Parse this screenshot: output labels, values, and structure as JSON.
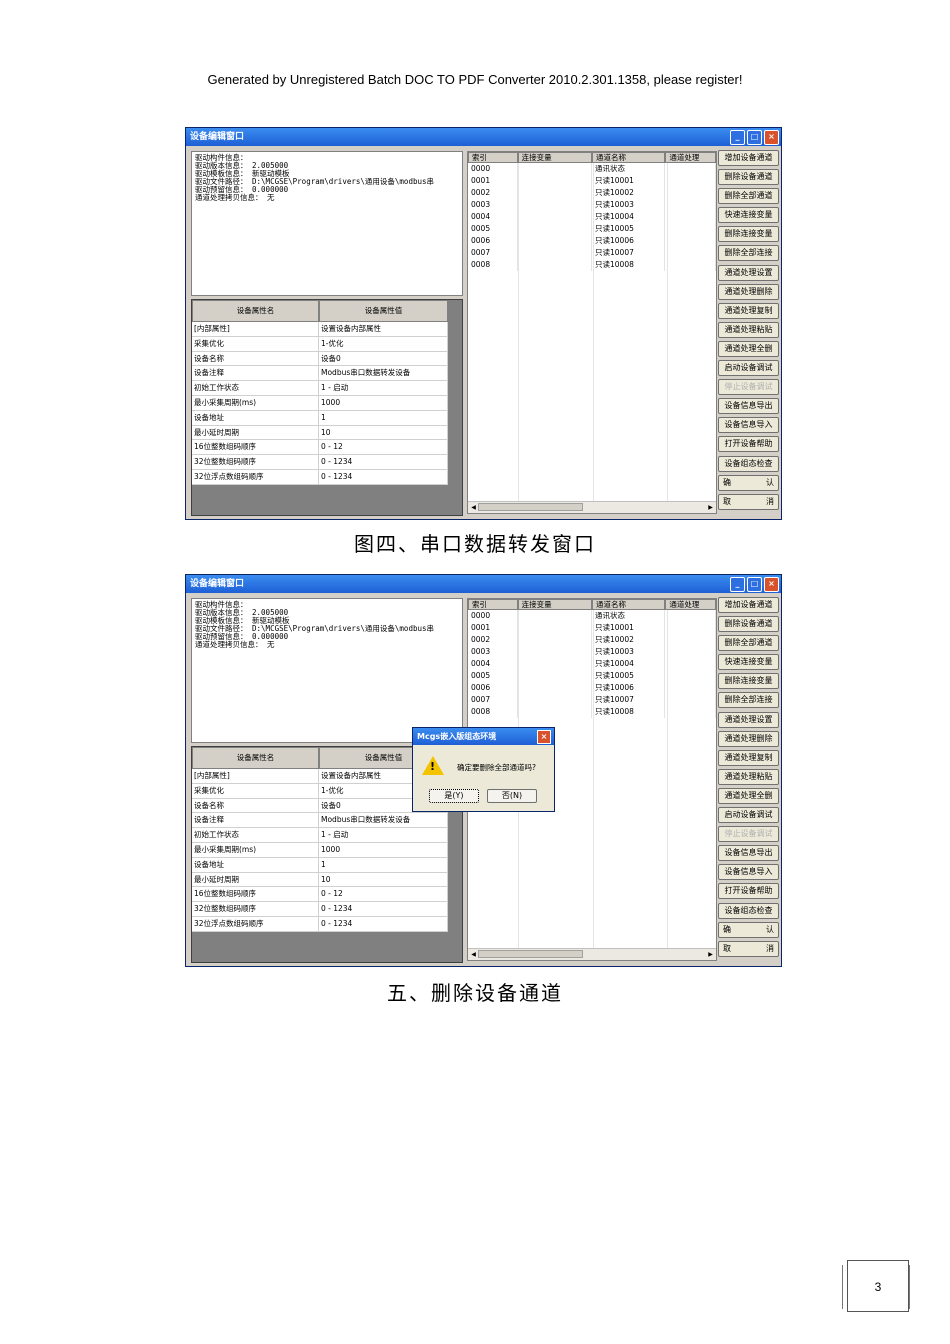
{
  "banner": "Generated by Unregistered Batch DOC TO PDF Converter 2010.2.301.1358, please register!",
  "figures": [
    {
      "title": "设备编辑窗口",
      "caption": "图四、串口数据转发窗口",
      "info_lines": [
        "驱动构件信息：",
        "驱动版本信息： 2.005000",
        "驱动模板信息： 新驱动模板",
        "驱动文件路径： D:\\MCGSE\\Program\\drivers\\通用设备\\modbus串",
        "驱动预留信息： 0.000000",
        "通道处理拷贝信息： 无"
      ],
      "prop_headers": [
        "设备属性名",
        "设备属性值"
      ],
      "props": [
        [
          "[内部属性]",
          "设置设备内部属性"
        ],
        [
          "采集优化",
          "1-优化"
        ],
        [
          "设备名称",
          "设备0"
        ],
        [
          "设备注释",
          "Modbus串口数据转发设备"
        ],
        [
          "初始工作状态",
          "1 - 启动"
        ],
        [
          "最小采集周期(ms)",
          "1000"
        ],
        [
          "设备地址",
          "1"
        ],
        [
          "最小延时周期",
          "10"
        ],
        [
          "16位整数组码顺序",
          "0 - 12"
        ],
        [
          "32位整数组码顺序",
          "0 - 1234"
        ],
        [
          "32位浮点数组码顺序",
          "0 - 1234"
        ]
      ],
      "chan_headers": [
        "索引",
        "连接变量",
        "通道名称",
        "通道处理"
      ],
      "channels": [
        [
          "0000",
          "",
          "通讯状态",
          ""
        ],
        [
          "0001",
          "",
          "只读10001",
          ""
        ],
        [
          "0002",
          "",
          "只读10002",
          ""
        ],
        [
          "0003",
          "",
          "只读10003",
          ""
        ],
        [
          "0004",
          "",
          "只读10004",
          ""
        ],
        [
          "0005",
          "",
          "只读10005",
          ""
        ],
        [
          "0006",
          "",
          "只读10006",
          ""
        ],
        [
          "0007",
          "",
          "只读10007",
          ""
        ],
        [
          "0008",
          "",
          "只读10008",
          ""
        ]
      ],
      "side_buttons": [
        "增加设备通道",
        "删除设备通道",
        "删除全部通道",
        "快速连接变量",
        "删除连接变量",
        "删除全部连接",
        "通道处理设置",
        "通道处理删除",
        "通道处理复制",
        "通道处理粘贴",
        "通道处理全删",
        "启动设备调试",
        "停止设备调试",
        "设备信息导出",
        "设备信息导入",
        "打开设备帮助",
        "设备组态检查"
      ],
      "confirm_left": "确",
      "confirm_right": "认",
      "cancel_left": "取",
      "cancel_right": "消"
    },
    {
      "title": "设备编辑窗口",
      "caption": "五、删除设备通道",
      "dialog": {
        "title": "Mcgs嵌入版组态环境",
        "message": "确定要删除全部通道吗?",
        "yes": "是(Y)",
        "no": "否(N)"
      }
    }
  ],
  "page_number": "3"
}
